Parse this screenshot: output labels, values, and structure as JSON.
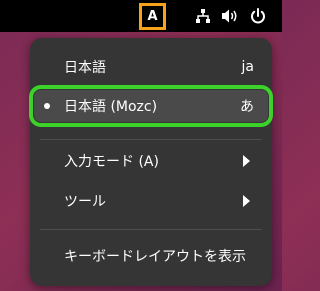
{
  "topbar": {
    "ime_indicator": "A",
    "network_icon": "network-icon",
    "volume_icon": "volume-icon",
    "power_icon": "power-icon"
  },
  "menu": {
    "items": [
      {
        "label": "日本語",
        "trail": "ja"
      },
      {
        "label": "日本語 (Mozc)",
        "trail": "あ",
        "selected": true
      },
      {
        "label": "入力モード (A)",
        "submenu": true
      },
      {
        "label": "ツール",
        "submenu": true
      },
      {
        "label": "キーボードレイアウトを表示"
      }
    ]
  },
  "colors": {
    "indicator_highlight": "#f6a21c",
    "selection_highlight": "#3cd22a",
    "menu_bg": "#353535"
  }
}
